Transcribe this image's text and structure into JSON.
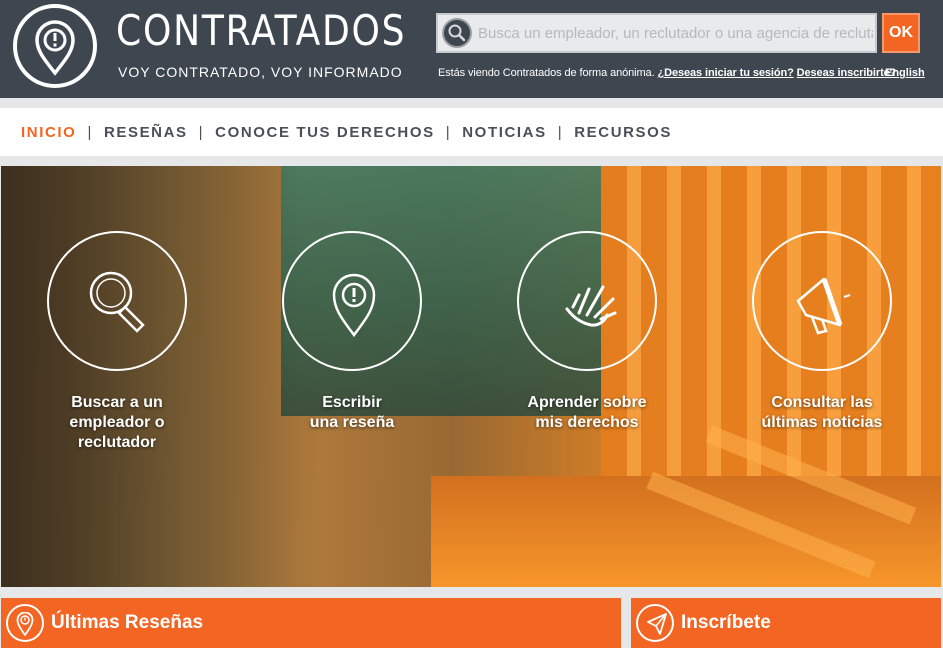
{
  "header": {
    "brand_name": "CONTRATADOS",
    "tagline": "VOY CONTRATADO, VOY INFORMADO",
    "search_placeholder": "Busca un empleador, un reclutador o una agencia de recluta",
    "ok_label": "OK",
    "session_text": "Estás viendo Contratados de forma anónima.",
    "login_link": "¿Deseas iniciar tu sesión?",
    "signup_link": "Deseas inscribirte?",
    "language_link": "English"
  },
  "nav": {
    "items": [
      {
        "label": "INICIO",
        "active": true
      },
      {
        "label": "RESEÑAS",
        "active": false
      },
      {
        "label": "CONOCE TUS DERECHOS",
        "active": false
      },
      {
        "label": "NOTICIAS",
        "active": false
      },
      {
        "label": "RECURSOS",
        "active": false
      }
    ],
    "separator": "|"
  },
  "hero": {
    "features": [
      {
        "icon": "search-icon",
        "label_line1": "Buscar a un",
        "label_line2": "empleador o",
        "label_line3": "reclutador"
      },
      {
        "icon": "location-pin-icon",
        "label_line1": "Escribir",
        "label_line2": "una reseña",
        "label_line3": ""
      },
      {
        "icon": "raised-hand-icon",
        "label_line1": "Aprender sobre",
        "label_line2": "mis derechos",
        "label_line3": ""
      },
      {
        "icon": "megaphone-icon",
        "label_line1": "Consultar las",
        "label_line2": "últimas noticias",
        "label_line3": ""
      }
    ]
  },
  "panels": {
    "reviews_title": "Últimas Reseñas",
    "signup_title": "Inscríbete"
  },
  "colors": {
    "header_bg": "#3e4650",
    "accent": "#f26522",
    "nav_text": "#4b5058"
  }
}
